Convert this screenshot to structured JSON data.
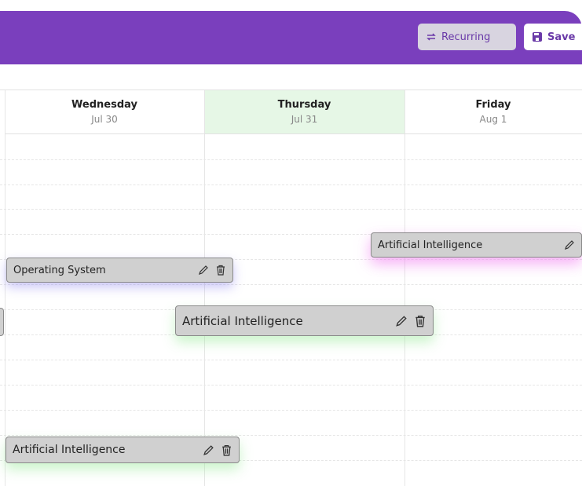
{
  "header": {
    "recurring_label": "Recurring",
    "save_label": "Save"
  },
  "days": [
    {
      "name": "Wednesday",
      "date": "Jul 30"
    },
    {
      "name": "Thursday",
      "date": "Jul 31"
    },
    {
      "name": "Friday",
      "date": "Aug 1"
    }
  ],
  "events": [
    {
      "title": "Operating System"
    },
    {
      "title": "Artificial Intelligence"
    },
    {
      "title": "Artificial Intelligence"
    },
    {
      "title": "Artificial Intelligence"
    }
  ],
  "colors": {
    "header_bg": "#7a3fbd",
    "today_highlight": "#e6f7e6",
    "event_bg": "#d0d0d0"
  },
  "icons": [
    "recurring-icon",
    "save-icon",
    "edit-icon",
    "delete-icon"
  ]
}
